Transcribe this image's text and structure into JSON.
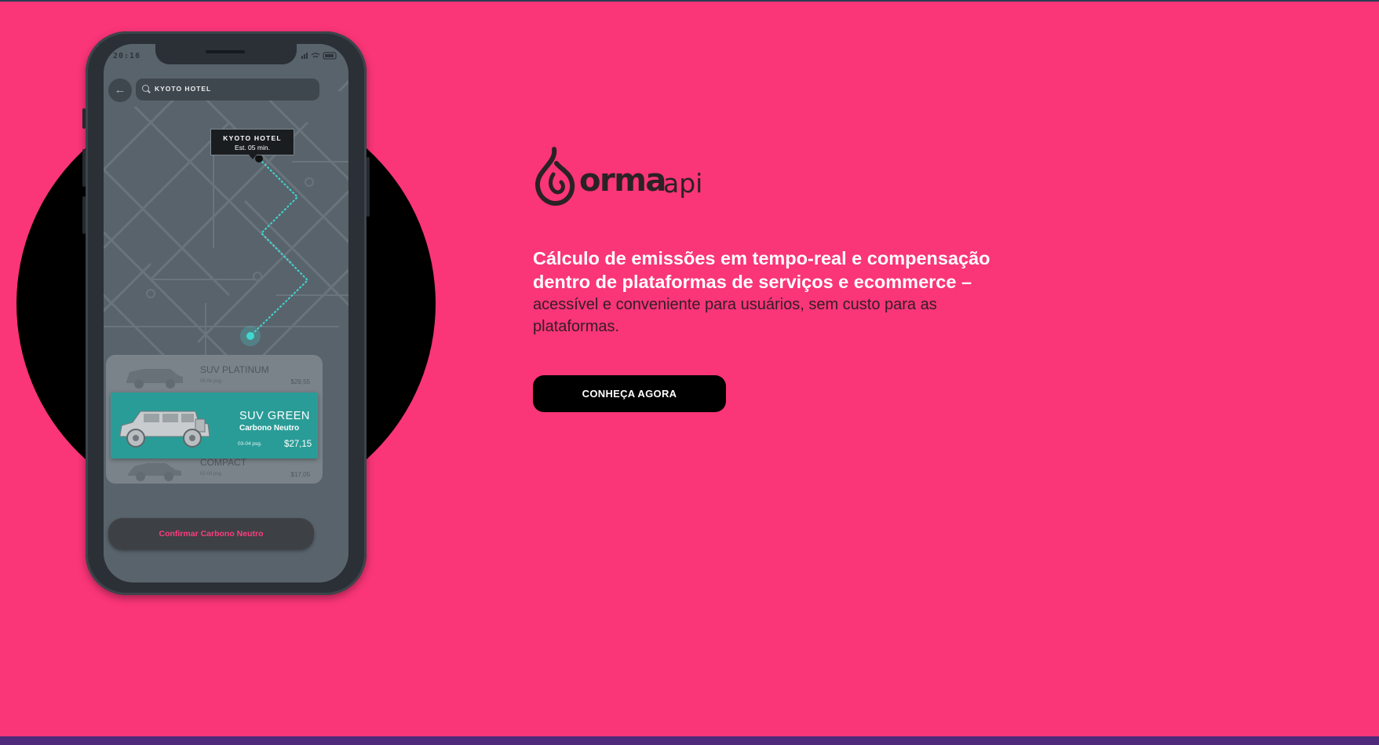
{
  "phone": {
    "status_time": "20:16",
    "search_text": "KYOTO HOTEL",
    "map_tooltip": {
      "title": "KYOTO HOTEL",
      "eta": "Est. 05 min."
    },
    "ride_options": [
      {
        "name": "SUV PLATINUM",
        "passengers": "05-06 psg.",
        "price": "$29,55"
      },
      {
        "name": "SUV GREEN",
        "subtitle": "Carbono Neutro",
        "passengers": "03-04 psg.",
        "price": "$27,15",
        "selected": true
      },
      {
        "name": "COMPACT",
        "passengers": "02-03 psg.",
        "price": "$17,05"
      }
    ],
    "confirm_label": "Confirmar Carbono Neutro"
  },
  "brand": {
    "logo_word": "orma",
    "logo_sub": "api"
  },
  "hero": {
    "headline": "Cálculo de emissões em tempo-real e compensação dentro de plataformas de serviços e ecommerce –",
    "subline": "acessível e conveniente para usuários, sem custo para as plataformas.",
    "cta_label": "CONHEÇA AGORA"
  },
  "colors": {
    "background": "#fa3578",
    "selected_ride": "#2a9c97",
    "route": "#3fd8d0",
    "cta": "#000000",
    "footer_bar": "#4f2a7a"
  }
}
